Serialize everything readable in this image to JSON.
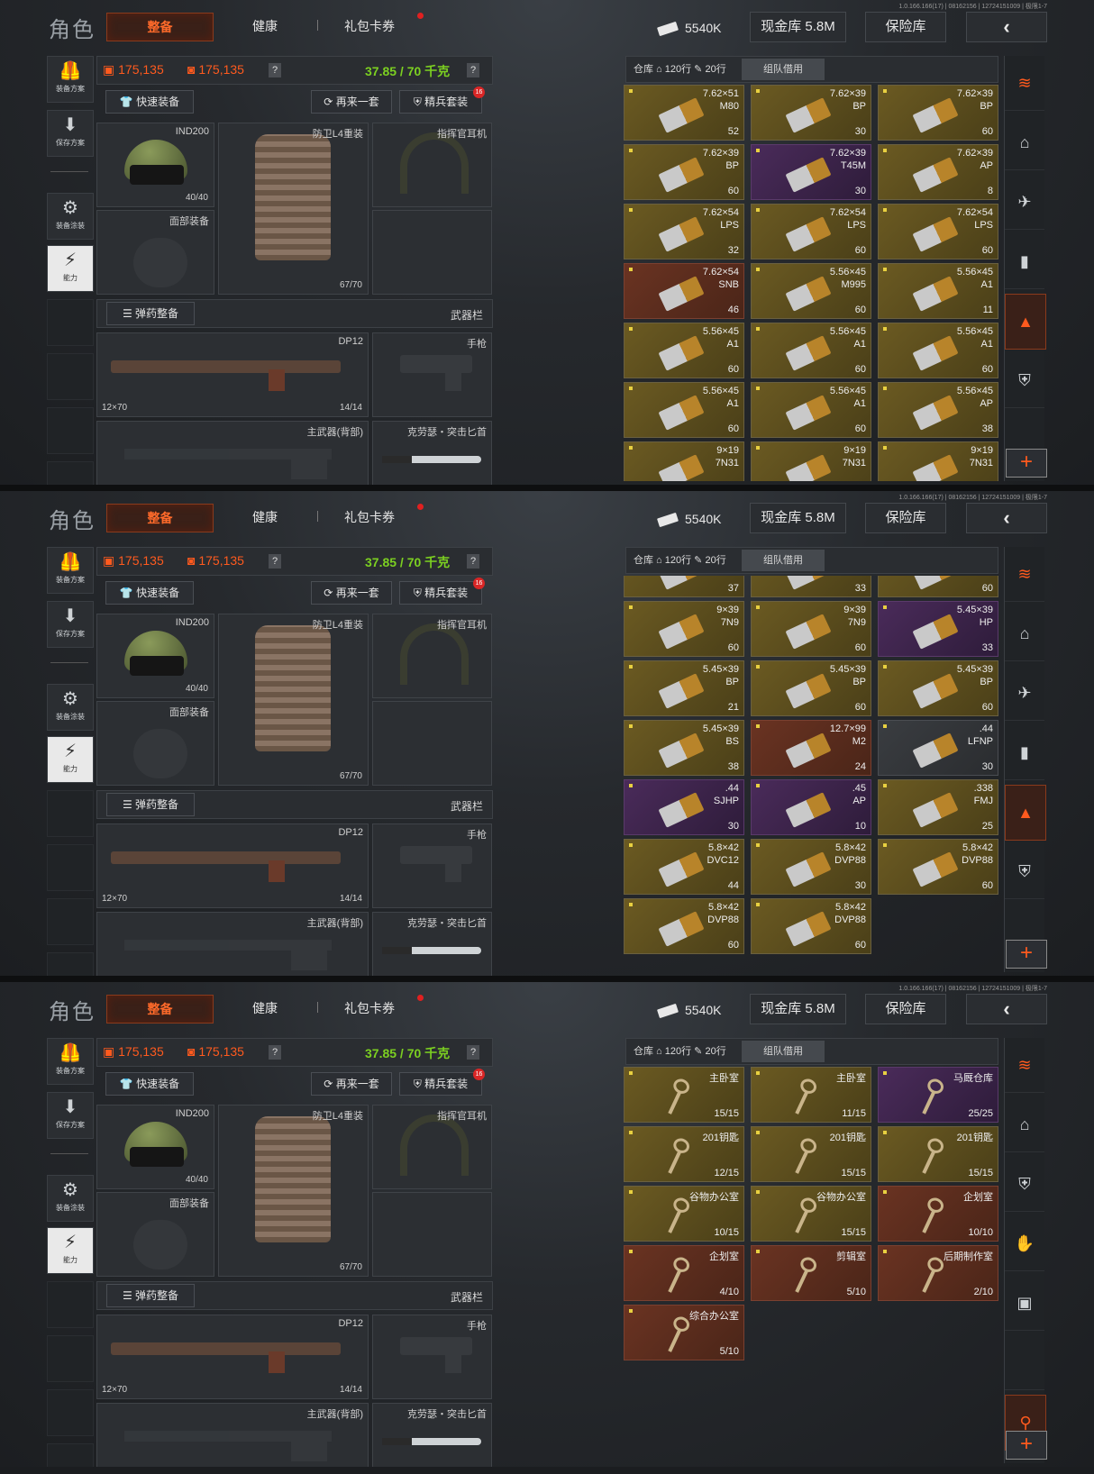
{
  "version": "1.0.166.166(17) | 08162156 | 12724151009 | 极限1-7",
  "title": "角色",
  "tabs": [
    "整备",
    "健康",
    "礼包卡券"
  ],
  "header": {
    "cash": "5540K",
    "vault": "现金库 5.8M",
    "safe": "保险库",
    "back": "‹"
  },
  "left_icons": [
    {
      "glyph": "🦺",
      "label": "装备方案",
      "name": "loadout-icon"
    },
    {
      "glyph": "⬇",
      "label": "保存方案",
      "name": "save-icon"
    },
    {
      "glyph": "⚙",
      "label": "装备涂装",
      "name": "paint-icon"
    },
    {
      "glyph": "⚡",
      "label": "能力",
      "name": "ability-icon"
    }
  ],
  "stats": {
    "armor1": "175,135",
    "armor2": "175,135",
    "weight": "37.85 / 70 千克",
    "help": "?"
  },
  "buttons": {
    "quick": "快速装备",
    "again": "再来一套",
    "elite": "精兵套装",
    "elite_badge": "16",
    "ammo": "弹药整备",
    "weapon_bar": "武器栏"
  },
  "gear": {
    "helmet": {
      "name": "IND200",
      "dur": "40/40"
    },
    "vest": {
      "name": "防卫L4重装",
      "dur": "67/70"
    },
    "headset": {
      "name": "指挥官耳机"
    },
    "face": {
      "name": "面部装备"
    },
    "rifle": {
      "name": "DP12",
      "cap": "12×70",
      "dur": "14/14"
    },
    "pistol": {
      "name": "手枪"
    },
    "back": {
      "name": "主武器(背部)"
    },
    "knife": {
      "name": "克劳瑟・突击匕首"
    }
  },
  "storage": {
    "label": "仓库",
    "rows1": "120行",
    "rows2": "20行",
    "borrow": "组队借用"
  },
  "panels": [
    {
      "scroll_offset": 0,
      "right_active": 4,
      "right_icons": [
        "layers",
        "⌂",
        "✈",
        "▮",
        "▲",
        "⛨"
      ],
      "items": [
        {
          "t1": "7.62×51",
          "t2": "M80",
          "q": "52",
          "c": "gold"
        },
        {
          "t1": "7.62×39",
          "t2": "BP",
          "q": "30",
          "c": "gold"
        },
        {
          "t1": "7.62×39",
          "t2": "BP",
          "q": "60",
          "c": "gold"
        },
        {
          "t1": "7.62×39",
          "t2": "BP",
          "q": "60",
          "c": "gold"
        },
        {
          "t1": "7.62×39",
          "t2": "T45M",
          "q": "30",
          "c": "purple"
        },
        {
          "t1": "7.62×39",
          "t2": "AP",
          "q": "8",
          "c": "gold"
        },
        {
          "t1": "7.62×54",
          "t2": "LPS",
          "q": "32",
          "c": "gold"
        },
        {
          "t1": "7.62×54",
          "t2": "LPS",
          "q": "60",
          "c": "gold"
        },
        {
          "t1": "7.62×54",
          "t2": "LPS",
          "q": "60",
          "c": "gold"
        },
        {
          "t1": "7.62×54",
          "t2": "SNB",
          "q": "46",
          "c": "red"
        },
        {
          "t1": "5.56×45",
          "t2": "M995",
          "q": "60",
          "c": "gold"
        },
        {
          "t1": "5.56×45",
          "t2": "A1",
          "q": "11",
          "c": "gold"
        },
        {
          "t1": "5.56×45",
          "t2": "A1",
          "q": "60",
          "c": "gold"
        },
        {
          "t1": "5.56×45",
          "t2": "A1",
          "q": "60",
          "c": "gold"
        },
        {
          "t1": "5.56×45",
          "t2": "A1",
          "q": "60",
          "c": "gold"
        },
        {
          "t1": "5.56×45",
          "t2": "A1",
          "q": "60",
          "c": "gold"
        },
        {
          "t1": "5.56×45",
          "t2": "A1",
          "q": "60",
          "c": "gold"
        },
        {
          "t1": "5.56×45",
          "t2": "AP",
          "q": "38",
          "c": "gold"
        },
        {
          "t1": "9×19",
          "t2": "7N31",
          "q": "",
          "c": "gold"
        },
        {
          "t1": "9×19",
          "t2": "7N31",
          "q": "",
          "c": "gold"
        },
        {
          "t1": "9×19",
          "t2": "7N31",
          "q": "",
          "c": "gold"
        }
      ]
    },
    {
      "scroll_offset": 1,
      "right_active": 4,
      "right_icons": [
        "layers",
        "⌂",
        "✈",
        "▮",
        "▲",
        "⛨"
      ],
      "items": [
        {
          "t1": "",
          "t2": "",
          "q": "37",
          "c": "gold"
        },
        {
          "t1": "",
          "t2": "",
          "q": "33",
          "c": "gold"
        },
        {
          "t1": "",
          "t2": "",
          "q": "60",
          "c": "gold"
        },
        {
          "t1": "9×39",
          "t2": "7N9",
          "q": "60",
          "c": "gold"
        },
        {
          "t1": "9×39",
          "t2": "7N9",
          "q": "60",
          "c": "gold"
        },
        {
          "t1": "5.45×39",
          "t2": "HP",
          "q": "33",
          "c": "purple"
        },
        {
          "t1": "5.45×39",
          "t2": "BP",
          "q": "21",
          "c": "gold"
        },
        {
          "t1": "5.45×39",
          "t2": "BP",
          "q": "60",
          "c": "gold"
        },
        {
          "t1": "5.45×39",
          "t2": "BP",
          "q": "60",
          "c": "gold"
        },
        {
          "t1": "5.45×39",
          "t2": "BS",
          "q": "38",
          "c": "gold"
        },
        {
          "t1": "12.7×99",
          "t2": "M2",
          "q": "24",
          "c": "red"
        },
        {
          "t1": ".44",
          "t2": "LFNP",
          "q": "30",
          "c": "gray"
        },
        {
          "t1": ".44",
          "t2": "SJHP",
          "q": "30",
          "c": "purple"
        },
        {
          "t1": ".45",
          "t2": "AP",
          "q": "10",
          "c": "purple"
        },
        {
          "t1": ".338",
          "t2": "FMJ",
          "q": "25",
          "c": "gold"
        },
        {
          "t1": "5.8×42",
          "t2": "DVC12",
          "q": "44",
          "c": "gold"
        },
        {
          "t1": "5.8×42",
          "t2": "DVP88",
          "q": "30",
          "c": "gold"
        },
        {
          "t1": "5.8×42",
          "t2": "DVP88",
          "q": "60",
          "c": "gold"
        },
        {
          "t1": "5.8×42",
          "t2": "DVP88",
          "q": "60",
          "c": "gold"
        },
        {
          "t1": "5.8×42",
          "t2": "DVP88",
          "q": "60",
          "c": "gold"
        }
      ]
    },
    {
      "scroll_offset": 0,
      "right_active": 6,
      "right_icons": [
        "layers",
        "⌂",
        "⛨",
        "✋",
        "▣",
        "",
        "⚲"
      ],
      "items": [
        {
          "t1": "主卧室",
          "t2": "",
          "q": "15/15",
          "c": "gold",
          "key": true
        },
        {
          "t1": "主卧室",
          "t2": "",
          "q": "11/15",
          "c": "gold",
          "key": true
        },
        {
          "t1": "马厩仓库",
          "t2": "",
          "q": "25/25",
          "c": "purple",
          "key": true
        },
        {
          "t1": "201钥匙",
          "t2": "",
          "q": "12/15",
          "c": "gold",
          "key": true
        },
        {
          "t1": "201钥匙",
          "t2": "",
          "q": "15/15",
          "c": "gold",
          "key": true
        },
        {
          "t1": "201钥匙",
          "t2": "",
          "q": "15/15",
          "c": "gold",
          "key": true
        },
        {
          "t1": "谷物办公室",
          "t2": "",
          "q": "10/15",
          "c": "gold",
          "key": true
        },
        {
          "t1": "谷物办公室",
          "t2": "",
          "q": "15/15",
          "c": "gold",
          "key": true
        },
        {
          "t1": "企划室",
          "t2": "",
          "q": "10/10",
          "c": "red",
          "key": true
        },
        {
          "t1": "企划室",
          "t2": "",
          "q": "4/10",
          "c": "red",
          "key": true
        },
        {
          "t1": "剪辑室",
          "t2": "",
          "q": "5/10",
          "c": "red",
          "key": true
        },
        {
          "t1": "后期制作室",
          "t2": "",
          "q": "2/10",
          "c": "red",
          "key": true
        },
        {
          "t1": "综合办公室",
          "t2": "",
          "q": "5/10",
          "c": "red",
          "key": true
        }
      ]
    }
  ]
}
